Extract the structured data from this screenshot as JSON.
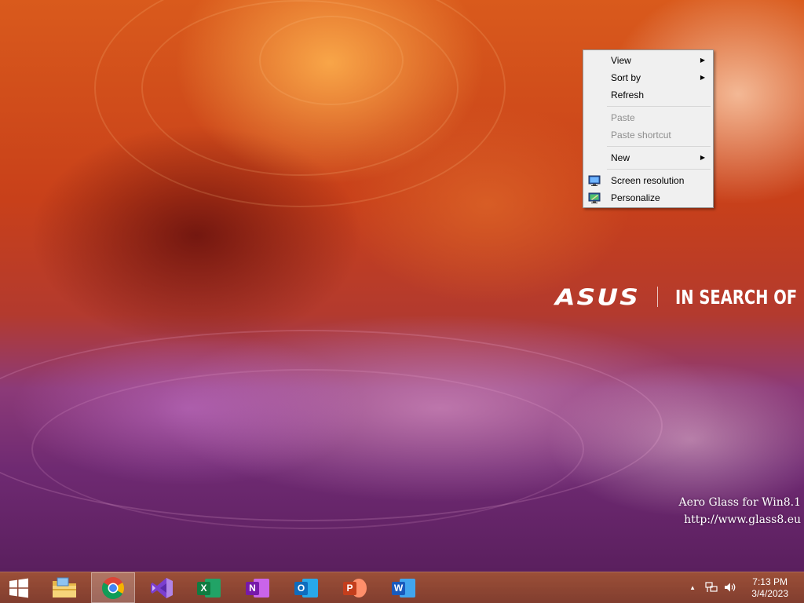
{
  "desktop": {
    "wallpaper_brand": "ASUS",
    "wallpaper_slogan": "IN SEARCH OF",
    "watermark_line1": "Aero Glass for Win8.1",
    "watermark_line2": "http://www.glass8.eu"
  },
  "context_menu": {
    "items": [
      {
        "label": "View",
        "has_submenu": true,
        "enabled": true
      },
      {
        "label": "Sort by",
        "has_submenu": true,
        "enabled": true
      },
      {
        "label": "Refresh",
        "has_submenu": false,
        "enabled": true
      },
      {
        "label": "Paste",
        "has_submenu": false,
        "enabled": false
      },
      {
        "label": "Paste shortcut",
        "has_submenu": false,
        "enabled": false
      },
      {
        "label": "New",
        "has_submenu": true,
        "enabled": true
      },
      {
        "label": "Screen resolution",
        "has_submenu": false,
        "enabled": true,
        "icon": "display-icon"
      },
      {
        "label": "Personalize",
        "has_submenu": false,
        "enabled": true,
        "icon": "personalize-icon"
      }
    ]
  },
  "taskbar": {
    "start_icon": "windows-logo-icon",
    "pinned_apps": [
      {
        "name": "file-explorer",
        "icon": "folder-icon",
        "active": false
      },
      {
        "name": "google-chrome",
        "icon": "chrome-icon",
        "active": true
      },
      {
        "name": "visual-studio",
        "icon": "visual-studio-icon",
        "active": false
      },
      {
        "name": "excel",
        "icon": "excel-icon",
        "letter": "X",
        "color": "#107c41",
        "active": false
      },
      {
        "name": "onenote",
        "icon": "onenote-icon",
        "letter": "N",
        "color": "#7719aa",
        "active": false
      },
      {
        "name": "outlook",
        "icon": "outlook-icon",
        "letter": "O",
        "color": "#0f6cbd",
        "active": false
      },
      {
        "name": "powerpoint",
        "icon": "powerpoint-icon",
        "letter": "P",
        "color": "#c43e1c",
        "active": false
      },
      {
        "name": "word",
        "icon": "word-icon",
        "letter": "W",
        "color": "#185abd",
        "active": false
      }
    ],
    "tray": {
      "time": "7:13 PM",
      "date": "3/4/2023",
      "icons": [
        "show-hidden-icons-arrow",
        "network-icon",
        "volume-icon"
      ]
    }
  }
}
